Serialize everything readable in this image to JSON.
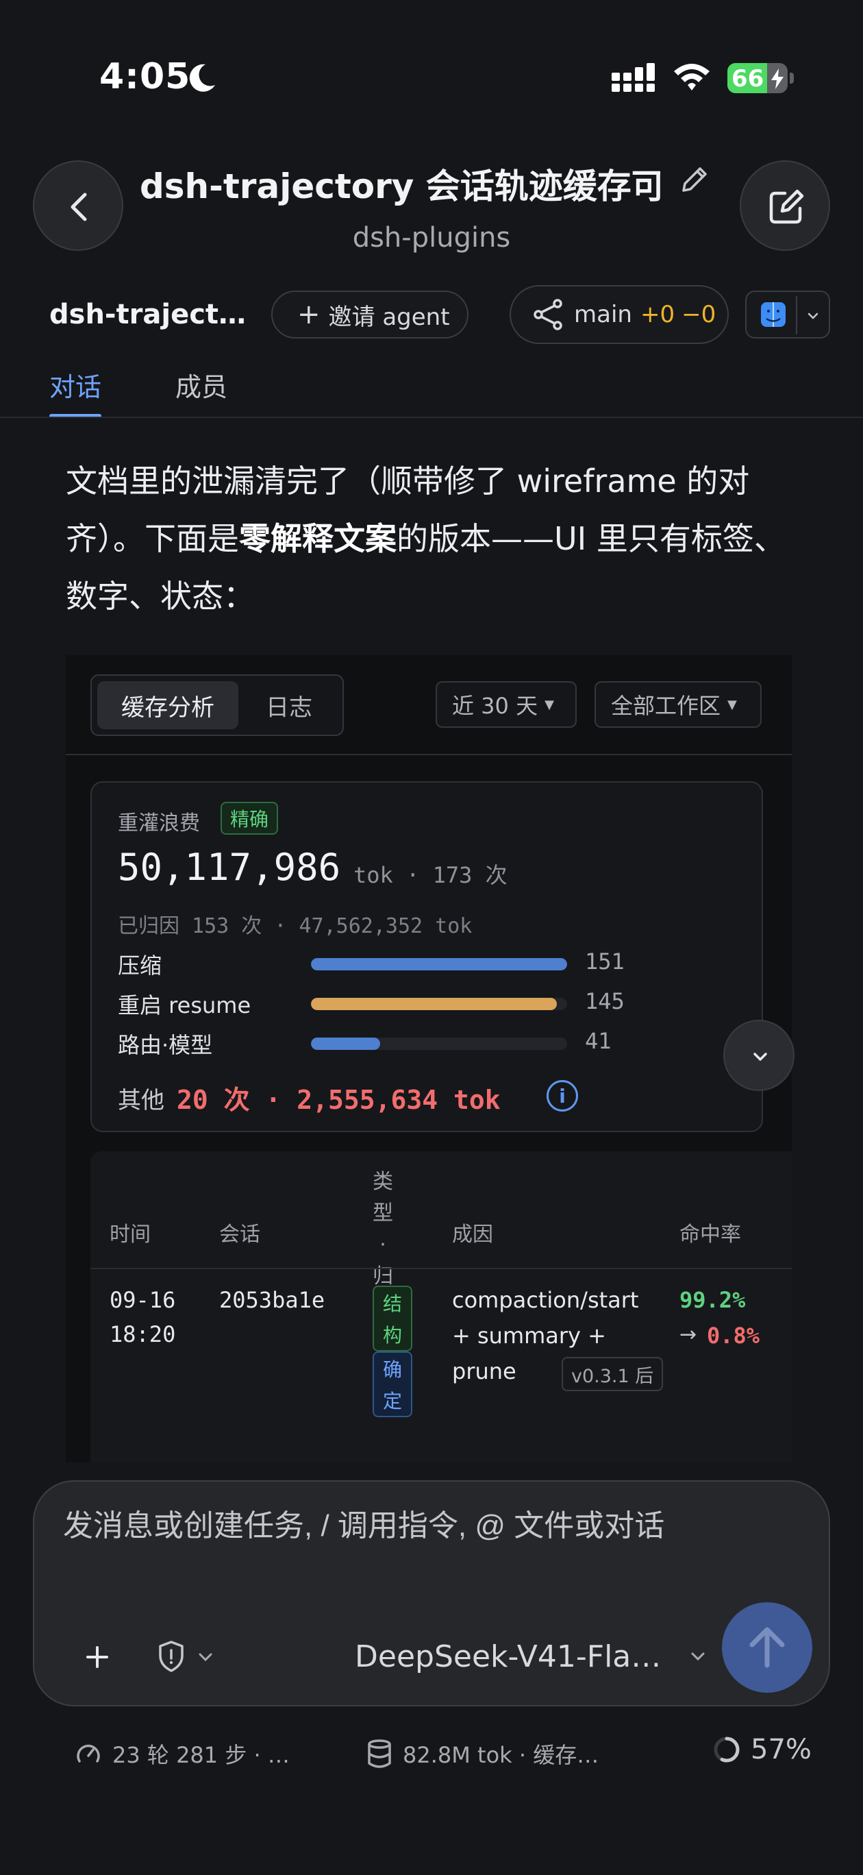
{
  "status_bar": {
    "time": "4:05",
    "battery": "66",
    "battery_level_percent": 66
  },
  "header": {
    "title": "dsh-trajectory 会话轨迹缓存可…",
    "subtitle": "dsh-plugins"
  },
  "toolbar": {
    "project_name": "dsh-traject…",
    "invite_label": "邀请 agent",
    "branch": "main",
    "added": "+0",
    "removed": "−0"
  },
  "tabs": [
    {
      "label": "对话",
      "active": true
    },
    {
      "label": "成员",
      "active": false
    }
  ],
  "message": {
    "part1": "文档里的泄漏清完了（顺带修了 wireframe 的对齐）。下面是",
    "bold": "零解释文案",
    "part2": "的版本——UI 里只有标签、数字、状态："
  },
  "panel": {
    "tabs": [
      "缓存分析",
      "日志"
    ],
    "range": "近 30 天",
    "workspace": "全部工作区",
    "card": {
      "label": "重灌浪费",
      "badge": "精确",
      "total": "50,117,986",
      "total_unit": "tok · 173 次",
      "attributed": "已归因 153 次 · 47,562,352 tok",
      "bars": [
        {
          "label": "压缩",
          "value": "151",
          "fraction": 1.0,
          "color": "#4f7fcf"
        },
        {
          "label": "重启 resume",
          "value": "145",
          "fraction": 0.96,
          "color": "#d9a55a"
        },
        {
          "label": "路由·模型",
          "value": "41",
          "fraction": 0.27,
          "color": "#4f7fcf"
        }
      ],
      "other_label": "其他",
      "other_value": "20 次 · 2,555,634 tok",
      "info": "i"
    },
    "table": {
      "headers": {
        "time": "时间",
        "session": "会话",
        "type": "类型·归因",
        "cause": "成因",
        "hit_rate": "命中率"
      },
      "rows": [
        {
          "date": "09-16",
          "time": "18:20",
          "session": "2053ba1e",
          "tag1": "结构",
          "tag2": "确定",
          "cause_l1": "compaction/start",
          "cause_l2": "+ summary +",
          "cause_l3": "prune",
          "version": "v0.3.1 后",
          "hit_from": "99.2%",
          "arrow": "→",
          "hit_to": "0.8%"
        }
      ]
    }
  },
  "composer": {
    "placeholder": "发消息或创建任务, / 调用指令, @ 文件或对话",
    "model": "DeepSeek-V41-Fla…"
  },
  "footer": {
    "steps": "23 轮 281 步 · …",
    "tokens": "82.8M tok · 缓存…",
    "progress": "57%",
    "progress_fraction": 0.57
  },
  "colors": {
    "accent": "#6ea3ff",
    "success": "#5fd17f",
    "danger": "#f26d6d",
    "warning": "#f0b429",
    "background": "#151619"
  }
}
